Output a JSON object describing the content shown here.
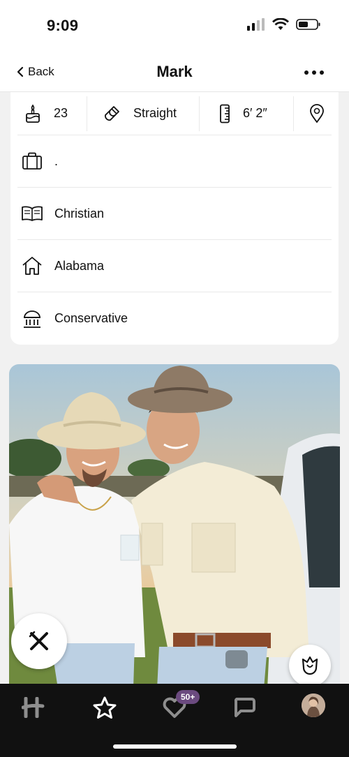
{
  "status_bar": {
    "time": "9:09"
  },
  "nav": {
    "back_label": "Back",
    "title": "Mark"
  },
  "stats": {
    "age": "23",
    "orientation": "Straight",
    "height": "6′ 2″"
  },
  "details": [
    {
      "icon": "briefcase-icon",
      "label": "."
    },
    {
      "icon": "book-icon",
      "label": "Christian"
    },
    {
      "icon": "home-icon",
      "label": "Alabama"
    },
    {
      "icon": "capitol-icon",
      "label": "Conservative"
    }
  ],
  "tabs": {
    "likes_badge": "50+"
  },
  "colors": {
    "tabbar_bg": "#111111",
    "badge_bg": "#6b4a7f"
  }
}
